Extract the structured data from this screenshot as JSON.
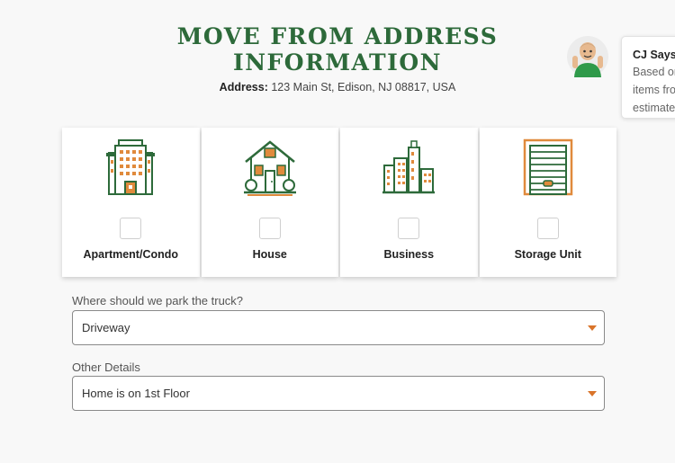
{
  "header": {
    "title_line1": "MOVE FROM ADDRESS",
    "title_line2": "INFORMATION",
    "address_label": "Address:",
    "address_value": "123 Main St, Edison, NJ 08817, USA"
  },
  "assistant": {
    "name": "CJ Says:",
    "lines": [
      "Based on",
      "items fron",
      "estimate"
    ]
  },
  "property_types": [
    {
      "label": "Apartment/Condo",
      "icon": "apartment-building-icon",
      "checked": false
    },
    {
      "label": "House",
      "icon": "house-icon",
      "checked": false
    },
    {
      "label": "Business",
      "icon": "city-buildings-icon",
      "checked": false
    },
    {
      "label": "Storage Unit",
      "icon": "storage-unit-icon",
      "checked": false
    }
  ],
  "parking": {
    "label": "Where should we park the truck?",
    "value": "Driveway"
  },
  "details": {
    "label": "Other Details",
    "value": "Home is on 1st Floor"
  },
  "colors": {
    "brand_green": "#2d6a3a",
    "accent_orange": "#d9742a"
  }
}
